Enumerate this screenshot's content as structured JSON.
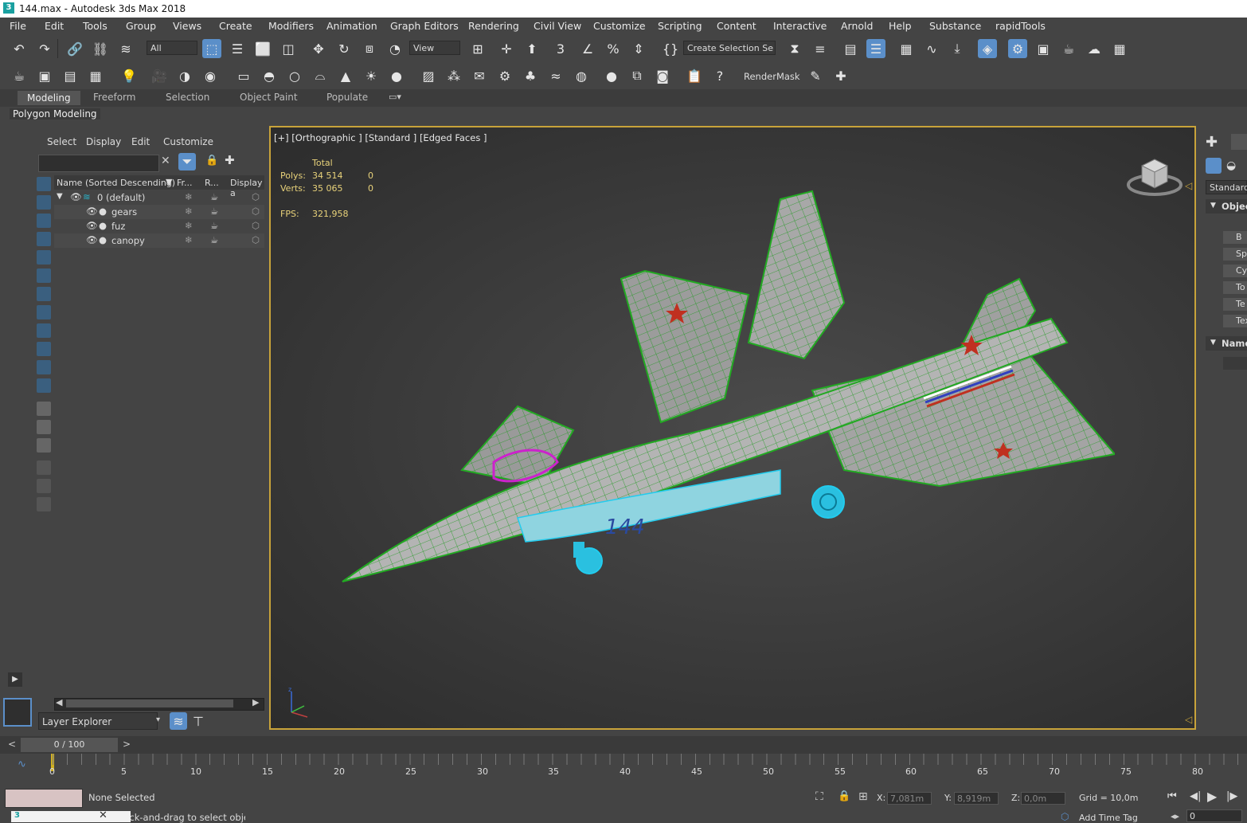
{
  "window": {
    "title": "144.max - Autodesk 3ds Max 2018",
    "app_icon": "3"
  },
  "menubar": {
    "items": [
      "File",
      "Edit",
      "Tools",
      "Group",
      "Views",
      "Create",
      "Modifiers",
      "Animation",
      "Graph Editors",
      "Rendering",
      "Civil View",
      "Customize",
      "Scripting",
      "Content",
      "Interactive",
      "Arnold",
      "Help",
      "Substance",
      "rapidTools"
    ]
  },
  "toolbar": {
    "selection_filter": "All",
    "reference_coord": "View",
    "named_selection": "Create Selection Se",
    "render_mask": "RenderMask"
  },
  "ribbon": {
    "tabs": [
      "Modeling",
      "Freeform",
      "Selection",
      "Object Paint",
      "Populate"
    ],
    "active_tab": "Modeling",
    "panel_label": "Polygon Modeling"
  },
  "scene_explorer": {
    "menu": [
      "Select",
      "Display",
      "Edit",
      "Customize"
    ],
    "columns": {
      "name": "Name (Sorted Descending)",
      "freeze": "Fr...",
      "render": "R...",
      "display": "Display a"
    },
    "layer": "0 (default)",
    "objects": [
      "gears",
      "fuz",
      "canopy"
    ],
    "footer": "Layer Explorer"
  },
  "viewport": {
    "label": "[+] [Orthographic ] [Standard ] [Edged Faces ]",
    "stats": {
      "header": "Total",
      "polys_label": "Polys:",
      "polys_total": "34 514",
      "polys_sel": "0",
      "verts_label": "Verts:",
      "verts_total": "35 065",
      "verts_sel": "0",
      "fps_label": "FPS:",
      "fps_value": "321,958"
    },
    "model_marking": "144"
  },
  "command_panel": {
    "dropdown": "Standard",
    "rollout_object": "Object",
    "rollout_name": "Name",
    "buttons": [
      "B",
      "Sp",
      "Cyl",
      "To",
      "Te",
      "Tex"
    ]
  },
  "timeline": {
    "frame_display": "0 / 100",
    "ticks": [
      "0",
      "5",
      "10",
      "15",
      "20",
      "25",
      "30",
      "35",
      "40",
      "45",
      "50",
      "55",
      "60",
      "65",
      "70",
      "75",
      "80"
    ]
  },
  "status": {
    "selection": "None Selected",
    "prompt": "Click-and-drag to select objects",
    "x_label": "X:",
    "x_value": "7,081m",
    "y_label": "Y:",
    "y_value": "8,919m",
    "z_label": "Z:",
    "z_value": "0,0m",
    "grid": "Grid = 10,0m",
    "add_time_tag": "Add Time Tag",
    "frame": "0"
  },
  "colors": {
    "accent": "#5b8fc9",
    "viewport_border": "#c8a33a",
    "wire_green": "#22aa22",
    "wire_cyan": "#22ccee",
    "wire_magenta": "#cc22cc"
  }
}
